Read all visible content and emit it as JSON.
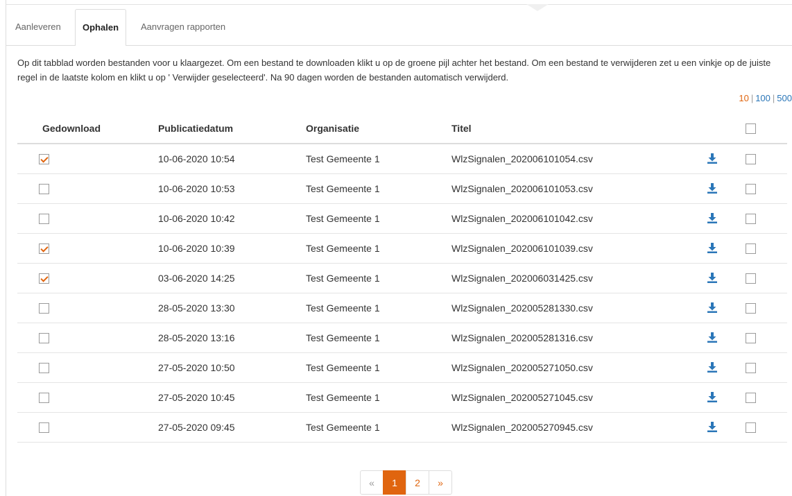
{
  "colors": {
    "accent": "#e0650f",
    "link": "#2a76b8",
    "download_icon": "#2a76b8"
  },
  "tabs": [
    {
      "label": "Aanleveren"
    },
    {
      "label": "Ophalen"
    },
    {
      "label": "Aanvragen rapporten"
    }
  ],
  "info_text": "Op dit tabblad worden bestanden voor u klaargezet. Om een bestand te downloaden klikt u op de groene pijl achter het bestand. Om een bestand te verwijderen zet u een vinkje op de juiste regel in de laatste kolom en klikt u op ' Verwijder geselecteerd'. Na 90 dagen worden de bestanden automatisch verwijderd.",
  "page_size": {
    "options": [
      "10",
      "100",
      "500"
    ],
    "separator": "|",
    "selected": "10"
  },
  "table": {
    "headers": {
      "downloaded": "Gedownload",
      "date": "Publicatiedatum",
      "organisation": "Organisatie",
      "title": "Titel"
    },
    "select_all_checked": false,
    "download_icon": "download-arrow-icon",
    "rows": [
      {
        "downloaded": true,
        "date": "10-06-2020 10:54",
        "organisation": "Test Gemeente 1",
        "title": "WlzSignalen_202006101054.csv",
        "selected": false
      },
      {
        "downloaded": false,
        "date": "10-06-2020 10:53",
        "organisation": "Test Gemeente 1",
        "title": "WlzSignalen_202006101053.csv",
        "selected": false
      },
      {
        "downloaded": false,
        "date": "10-06-2020 10:42",
        "organisation": "Test Gemeente 1",
        "title": "WlzSignalen_202006101042.csv",
        "selected": false
      },
      {
        "downloaded": true,
        "date": "10-06-2020 10:39",
        "organisation": "Test Gemeente 1",
        "title": "WlzSignalen_202006101039.csv",
        "selected": false
      },
      {
        "downloaded": true,
        "date": "03-06-2020 14:25",
        "organisation": "Test Gemeente 1",
        "title": "WlzSignalen_202006031425.csv",
        "selected": false
      },
      {
        "downloaded": false,
        "date": "28-05-2020 13:30",
        "organisation": "Test Gemeente 1",
        "title": "WlzSignalen_202005281330.csv",
        "selected": false
      },
      {
        "downloaded": false,
        "date": "28-05-2020 13:16",
        "organisation": "Test Gemeente 1",
        "title": "WlzSignalen_202005281316.csv",
        "selected": false
      },
      {
        "downloaded": false,
        "date": "27-05-2020 10:50",
        "organisation": "Test Gemeente 1",
        "title": "WlzSignalen_202005271050.csv",
        "selected": false
      },
      {
        "downloaded": false,
        "date": "27-05-2020 10:45",
        "organisation": "Test Gemeente 1",
        "title": "WlzSignalen_202005271045.csv",
        "selected": false
      },
      {
        "downloaded": false,
        "date": "27-05-2020 09:45",
        "organisation": "Test Gemeente 1",
        "title": "WlzSignalen_202005270945.csv",
        "selected": false
      }
    ]
  },
  "pagination": {
    "prev": "«",
    "pages": [
      "1",
      "2"
    ],
    "current": "1",
    "next": "»"
  }
}
